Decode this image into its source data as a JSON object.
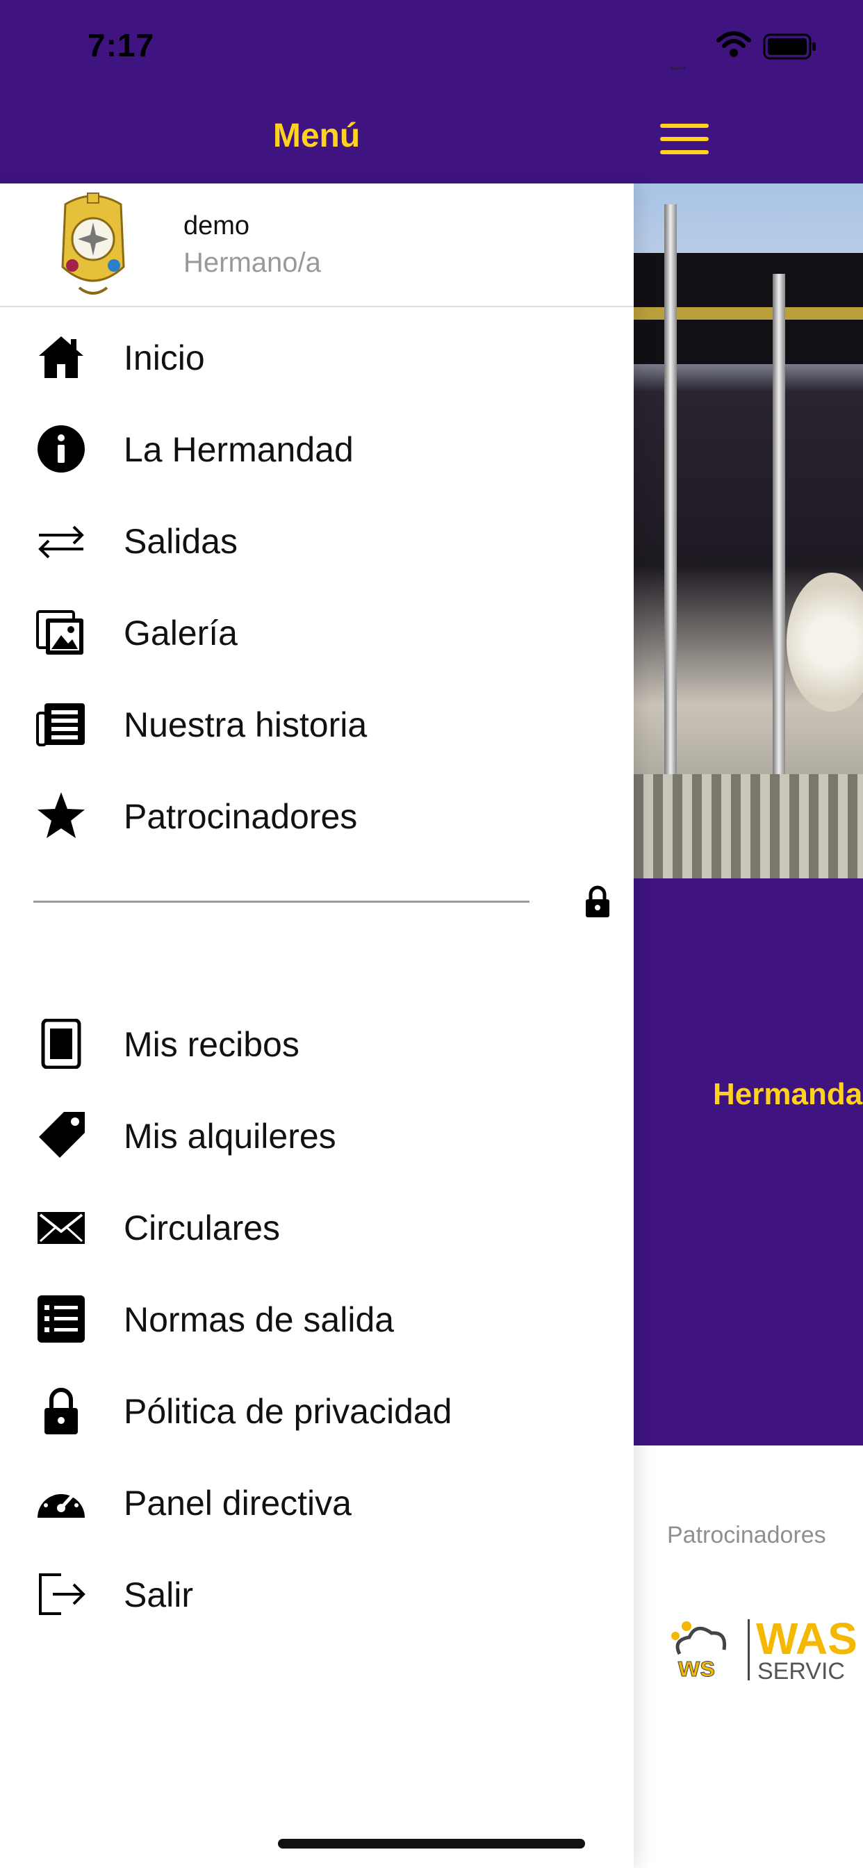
{
  "status_bar": {
    "time": "7:17",
    "signal": "....."
  },
  "nav": {
    "title": "Menú"
  },
  "profile": {
    "name": "demo",
    "role": "Hermano/a"
  },
  "menu_primary": [
    {
      "label": "Inicio",
      "icon": "home-icon"
    },
    {
      "label": "La Hermandad",
      "icon": "info-icon"
    },
    {
      "label": "Salidas",
      "icon": "swap-arrows-icon"
    },
    {
      "label": "Galería",
      "icon": "photos-icon"
    },
    {
      "label": "Nuestra historia",
      "icon": "newspaper-icon"
    },
    {
      "label": "Patrocinadores",
      "icon": "star-icon"
    }
  ],
  "menu_secondary": [
    {
      "label": "Mis recibos",
      "icon": "receipt-icon"
    },
    {
      "label": "Mis alquileres",
      "icon": "tag-icon"
    },
    {
      "label": "Circulares",
      "icon": "envelope-icon"
    },
    {
      "label": "Normas de salida",
      "icon": "list-icon"
    },
    {
      "label": "Pólitica de privacidad",
      "icon": "lock-icon"
    },
    {
      "label": "Panel directiva",
      "icon": "dashboard-icon"
    },
    {
      "label": "Salir",
      "icon": "logout-icon"
    }
  ],
  "content": {
    "banner_text": "Hermandad",
    "sponsors_label": "Patrocinadores",
    "sponsor_logo_text": "WAS",
    "sponsor_logo_sub": "SERVIC"
  },
  "colors": {
    "brand_purple": "#3f1480",
    "accent_yellow": "#ffd21f"
  }
}
